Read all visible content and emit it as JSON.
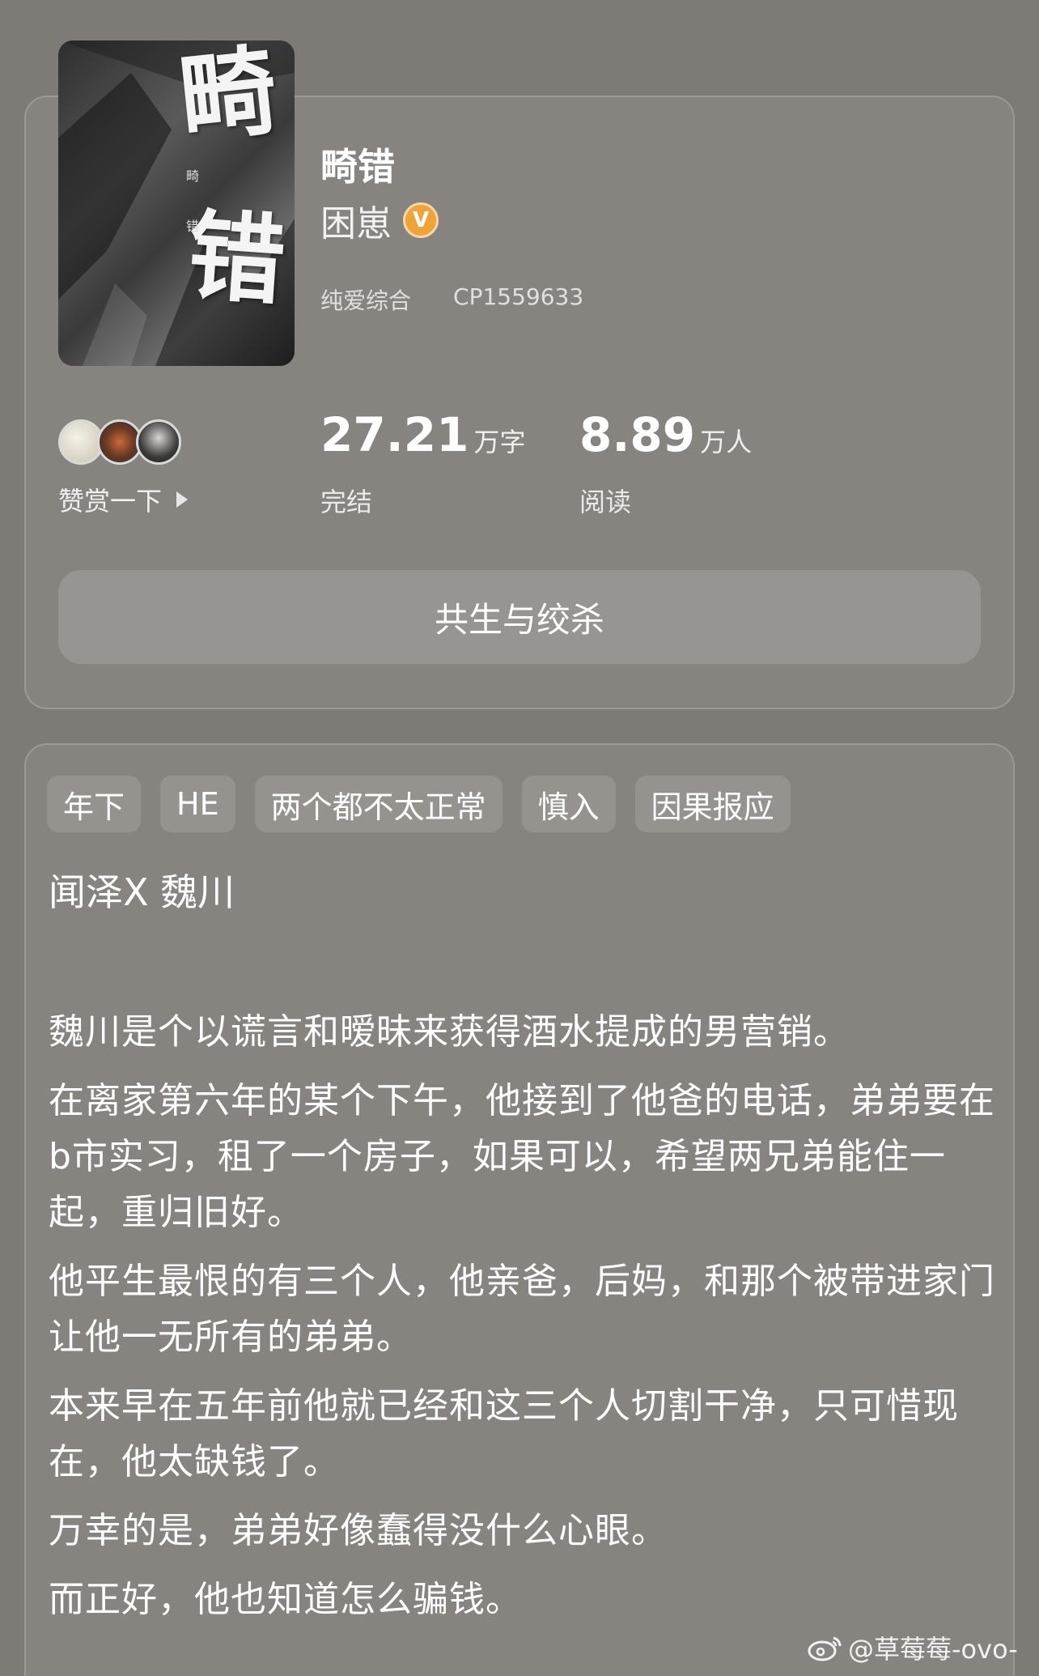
{
  "cover": {
    "title_chars": [
      "畸",
      "错"
    ],
    "small_chars": [
      "畸",
      "错"
    ]
  },
  "book": {
    "title": "畸错",
    "author": "困崽",
    "verified_badge": "V",
    "category": "纯爱综合",
    "cp_id": "CP1559633"
  },
  "tip": {
    "label": "赞赏一下"
  },
  "stats": {
    "words_value": "27.21",
    "words_unit": "万字",
    "words_label": "完结",
    "reads_value": "8.89",
    "reads_unit": "万人",
    "reads_label": "阅读"
  },
  "main_tag": "共生与绞杀",
  "tags": [
    "年下",
    "HE",
    "两个都不太正常",
    "慎入",
    "因果报应"
  ],
  "cp_line": "闻泽X 魏川",
  "synopsis": [
    "魏川是个以谎言和暧昧来获得酒水提成的男营销。",
    "在离家第六年的某个下午，他接到了他爸的电话，弟弟要在b市实习，租了一个房子，如果可以，希望两兄弟能住一起，重归旧好。",
    "他平生最恨的有三个人，他亲爸，后妈，和那个被带进家门让他一无所有的弟弟。",
    "本来早在五年前他就已经和这三个人切割干净，只可惜现在，他太缺钱了。",
    "万幸的是，弟弟好像蠢得没什么心眼。",
    "而正好，他也知道怎么骗钱。"
  ],
  "watermark": "@草莓莓-ovo-",
  "colors": {
    "background": "#7e7a76",
    "verified_badge": "#f0a23b"
  }
}
